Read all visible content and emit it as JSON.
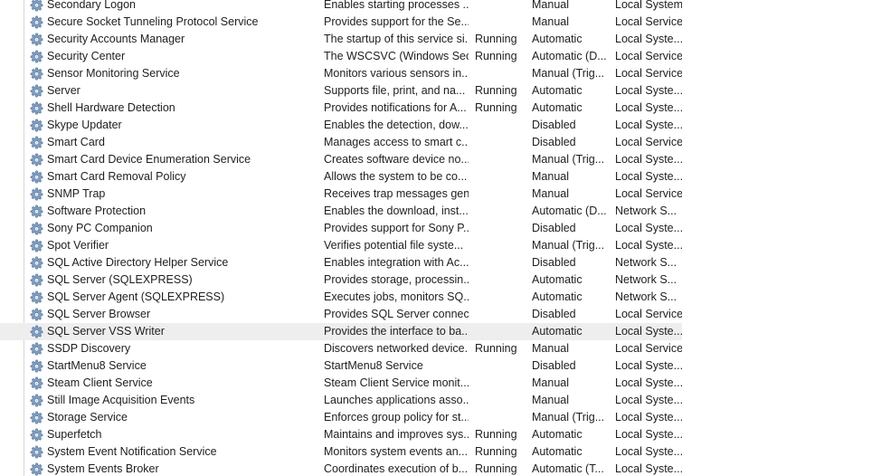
{
  "services": [
    {
      "name": "Secondary Logon",
      "description": "Enables starting processes ...",
      "status": "",
      "startup": "Manual",
      "logon": "Local System"
    },
    {
      "name": "Secure Socket Tunneling Protocol Service",
      "description": "Provides support for the Se...",
      "status": "",
      "startup": "Manual",
      "logon": "Local Service"
    },
    {
      "name": "Security Accounts Manager",
      "description": "The startup of this service si...",
      "status": "Running",
      "startup": "Automatic",
      "logon": "Local Syste..."
    },
    {
      "name": "Security Center",
      "description": "The WSCSVC (Windows Sec...",
      "status": "Running",
      "startup": "Automatic (D...",
      "logon": "Local Service"
    },
    {
      "name": "Sensor Monitoring Service",
      "description": "Monitors various sensors in...",
      "status": "",
      "startup": "Manual (Trig...",
      "logon": "Local Service"
    },
    {
      "name": "Server",
      "description": "Supports file, print, and na...",
      "status": "Running",
      "startup": "Automatic",
      "logon": "Local Syste..."
    },
    {
      "name": "Shell Hardware Detection",
      "description": "Provides notifications for A...",
      "status": "Running",
      "startup": "Automatic",
      "logon": "Local Syste..."
    },
    {
      "name": "Skype Updater",
      "description": "Enables the detection, dow...",
      "status": "",
      "startup": "Disabled",
      "logon": "Local Syste..."
    },
    {
      "name": "Smart Card",
      "description": "Manages access to smart c...",
      "status": "",
      "startup": "Disabled",
      "logon": "Local Service"
    },
    {
      "name": "Smart Card Device Enumeration Service",
      "description": "Creates software device no...",
      "status": "",
      "startup": "Manual (Trig...",
      "logon": "Local Syste..."
    },
    {
      "name": "Smart Card Removal Policy",
      "description": "Allows the system to be co...",
      "status": "",
      "startup": "Manual",
      "logon": "Local Syste..."
    },
    {
      "name": "SNMP Trap",
      "description": "Receives trap messages gen...",
      "status": "",
      "startup": "Manual",
      "logon": "Local Service"
    },
    {
      "name": "Software Protection",
      "description": "Enables the download, inst...",
      "status": "",
      "startup": "Automatic (D...",
      "logon": "Network S..."
    },
    {
      "name": "Sony PC Companion",
      "description": "Provides support for Sony P...",
      "status": "",
      "startup": "Disabled",
      "logon": "Local Syste..."
    },
    {
      "name": "Spot Verifier",
      "description": "Verifies potential file syste...",
      "status": "",
      "startup": "Manual (Trig...",
      "logon": "Local Syste..."
    },
    {
      "name": "SQL Active Directory Helper Service",
      "description": "Enables integration with Ac...",
      "status": "",
      "startup": "Disabled",
      "logon": "Network S..."
    },
    {
      "name": "SQL Server (SQLEXPRESS)",
      "description": "Provides storage, processin...",
      "status": "",
      "startup": "Automatic",
      "logon": "Network S..."
    },
    {
      "name": "SQL Server Agent (SQLEXPRESS)",
      "description": "Executes jobs, monitors SQ...",
      "status": "",
      "startup": "Automatic",
      "logon": "Network S..."
    },
    {
      "name": "SQL Server Browser",
      "description": "Provides SQL Server connec...",
      "status": "",
      "startup": "Disabled",
      "logon": "Local Service"
    },
    {
      "name": "SQL Server VSS Writer",
      "description": "Provides the interface to ba...",
      "status": "",
      "startup": "Automatic",
      "logon": "Local Syste...",
      "selected": true
    },
    {
      "name": "SSDP Discovery",
      "description": "Discovers networked device...",
      "status": "Running",
      "startup": "Manual",
      "logon": "Local Service"
    },
    {
      "name": "StartMenu8 Service",
      "description": "StartMenu8 Service",
      "status": "",
      "startup": "Disabled",
      "logon": "Local Syste..."
    },
    {
      "name": "Steam Client Service",
      "description": "Steam Client Service monit...",
      "status": "",
      "startup": "Manual",
      "logon": "Local Syste..."
    },
    {
      "name": "Still Image Acquisition Events",
      "description": "Launches applications asso...",
      "status": "",
      "startup": "Manual",
      "logon": "Local Syste..."
    },
    {
      "name": "Storage Service",
      "description": "Enforces group policy for st...",
      "status": "",
      "startup": "Manual (Trig...",
      "logon": "Local Syste..."
    },
    {
      "name": "Superfetch",
      "description": "Maintains and improves sys...",
      "status": "Running",
      "startup": "Automatic",
      "logon": "Local Syste..."
    },
    {
      "name": "System Event Notification Service",
      "description": "Monitors system events an...",
      "status": "Running",
      "startup": "Automatic",
      "logon": "Local Syste..."
    },
    {
      "name": "System Events Broker",
      "description": "Coordinates execution of b...",
      "status": "Running",
      "startup": "Automatic (T...",
      "logon": "Local Syste..."
    }
  ],
  "icon": "gear-icon"
}
